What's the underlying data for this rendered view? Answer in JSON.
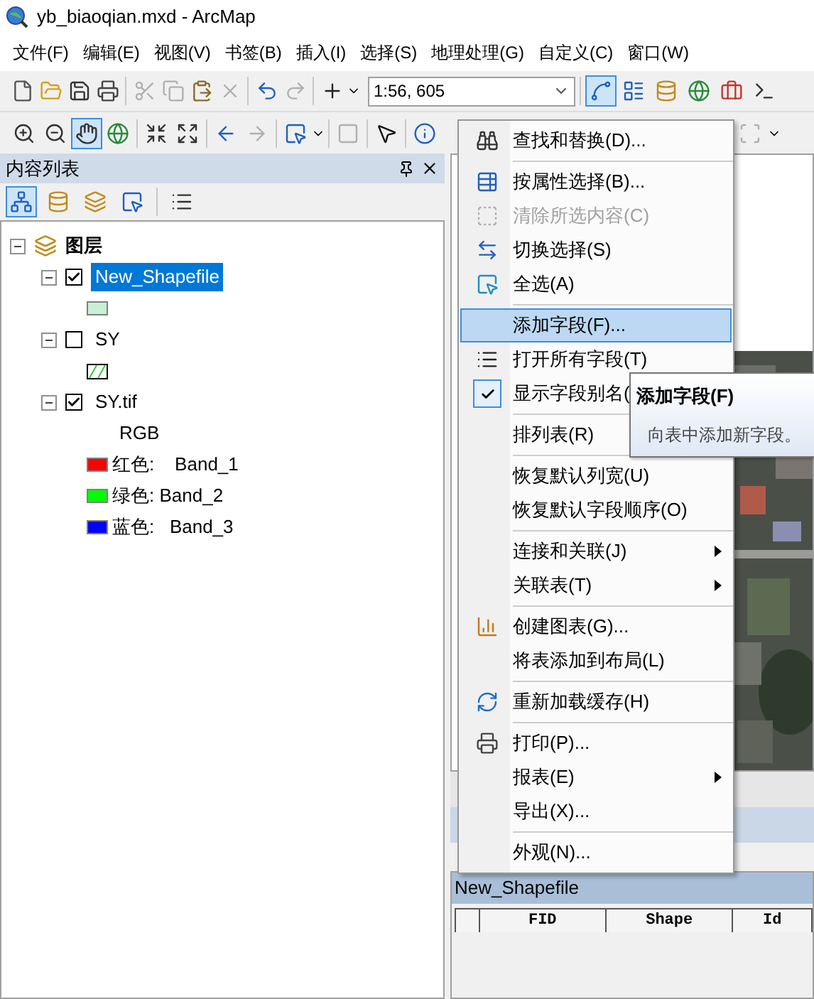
{
  "window": {
    "title": "yb_biaoqian.mxd - ArcMap"
  },
  "menu_bar": [
    "文件(F)",
    "编辑(E)",
    "视图(V)",
    "书签(B)",
    "插入(I)",
    "选择(S)",
    "地理处理(G)",
    "自定义(C)",
    "窗口(W)"
  ],
  "toolbar_1": {
    "buttons": [
      {
        "disabled": false
      },
      {
        "disabled": false
      },
      {
        "disabled": false
      },
      {
        "disabled": false
      },
      {
        "disabled": true
      },
      {
        "disabled": true
      },
      {
        "disabled": false
      },
      {
        "disabled": true
      },
      {
        "disabled": false
      },
      {
        "disabled": true
      },
      {
        "disabled": false
      }
    ],
    "scale": "1:56, 605",
    "tools": [
      {
        "selected": true
      },
      {
        "selected": false
      },
      {
        "selected": false
      },
      {
        "selected": false
      },
      {
        "selected": false
      },
      {
        "selected": false
      }
    ]
  },
  "toolbar_2": {
    "buttons": [
      {
        "selected": false,
        "disabled": false
      },
      {
        "selected": false,
        "disabled": false
      },
      {
        "selected": true,
        "disabled": false
      },
      {
        "selected": false,
        "disabled": false
      },
      {
        "selected": false,
        "disabled": false
      },
      {
        "selected": false,
        "disabled": false
      },
      {
        "selected": false,
        "disabled": false
      },
      {
        "selected": false,
        "disabled": true
      },
      {
        "selected": false,
        "disabled": false
      },
      {
        "selected": false,
        "disabled": true
      },
      {
        "selected": false,
        "disabled": false
      },
      {
        "selected": false,
        "disabled": false
      },
      {
        "selected": false,
        "disabled": true
      }
    ]
  },
  "toc": {
    "title": "内容列表",
    "tools": [
      {
        "selected": true
      },
      {
        "selected": false
      },
      {
        "selected": false
      },
      {
        "selected": false
      },
      {
        "selected": false
      }
    ],
    "tree": {
      "label": "图层",
      "expanded": true,
      "children": [
        {
          "label": "New_Shapefile",
          "checked": true,
          "selected": true,
          "expanded": true,
          "legend": [
            {
              "kind": "fill",
              "color": "#c8f0d4"
            }
          ]
        },
        {
          "label": "SY",
          "checked": false,
          "selected": false,
          "expanded": true,
          "legend": [
            {
              "kind": "hatch",
              "color": "#33cc33"
            }
          ]
        },
        {
          "label": "SY.tif",
          "checked": true,
          "selected": false,
          "expanded": true,
          "legend": [
            {
              "kind": "text",
              "label": "RGB"
            },
            {
              "kind": "band",
              "color": "#ff0000",
              "label": "红色:    Band_1"
            },
            {
              "kind": "band",
              "color": "#00ff00",
              "label": "绿色: Band_2"
            },
            {
              "kind": "band",
              "color": "#0000ff",
              "label": "蓝色:   Band_3"
            }
          ]
        }
      ]
    }
  },
  "context_menu": [
    {
      "kind": "item",
      "label": "查找和替换(D)...",
      "selected": false,
      "disabled": false,
      "checked": false
    },
    {
      "kind": "separator"
    },
    {
      "kind": "item",
      "label": "按属性选择(B)...",
      "selected": false,
      "disabled": false,
      "checked": false
    },
    {
      "kind": "item",
      "label": "清除所选内容(C)",
      "selected": false,
      "disabled": true,
      "checked": false
    },
    {
      "kind": "item",
      "label": "切换选择(S)",
      "selected": false,
      "disabled": false,
      "checked": false
    },
    {
      "kind": "item",
      "label": "全选(A)",
      "selected": false,
      "disabled": false,
      "checked": false
    },
    {
      "kind": "separator"
    },
    {
      "kind": "item",
      "label": "添加字段(F)...",
      "selected": true,
      "disabled": false,
      "checked": false
    },
    {
      "kind": "item",
      "label": "打开所有字段(T)",
      "selected": false,
      "disabled": false,
      "checked": false
    },
    {
      "kind": "item",
      "label": "显示字段别名(",
      "selected": false,
      "disabled": false,
      "checked": true
    },
    {
      "kind": "separator"
    },
    {
      "kind": "item",
      "label": "排列表(R)",
      "selected": false,
      "disabled": false,
      "checked": false
    },
    {
      "kind": "separator"
    },
    {
      "kind": "item",
      "label": "恢复默认列宽(U)",
      "selected": false,
      "disabled": false,
      "checked": false
    },
    {
      "kind": "item",
      "label": "恢复默认字段顺序(O)",
      "selected": false,
      "disabled": false,
      "checked": false
    },
    {
      "kind": "separator"
    },
    {
      "kind": "submenu",
      "label": "连接和关联(J)",
      "selected": false,
      "disabled": false,
      "checked": false
    },
    {
      "kind": "submenu",
      "label": "关联表(T)",
      "selected": false,
      "disabled": false,
      "checked": false
    },
    {
      "kind": "separator"
    },
    {
      "kind": "item",
      "label": "创建图表(G)...",
      "selected": false,
      "disabled": false,
      "checked": false
    },
    {
      "kind": "item",
      "label": "将表添加到布局(L)",
      "selected": false,
      "disabled": false,
      "checked": false
    },
    {
      "kind": "separator"
    },
    {
      "kind": "item",
      "label": "重新加载缓存(H)",
      "selected": false,
      "disabled": false,
      "checked": false
    },
    {
      "kind": "separator"
    },
    {
      "kind": "item",
      "label": "打印(P)...",
      "selected": false,
      "disabled": false,
      "checked": false
    },
    {
      "kind": "submenu",
      "label": "报表(E)",
      "selected": false,
      "disabled": false,
      "checked": false
    },
    {
      "kind": "item",
      "label": "导出(X)...",
      "selected": false,
      "disabled": false,
      "checked": false
    },
    {
      "kind": "separator"
    },
    {
      "kind": "item",
      "label": "外观(N)...",
      "selected": false,
      "disabled": false,
      "checked": false
    }
  ],
  "tooltip": {
    "title": "添加字段(F)",
    "text": "向表中添加新字段。"
  },
  "table_window": {
    "title": "New_Shapefile",
    "columns": [
      "FID",
      "Shape",
      "Id"
    ]
  }
}
